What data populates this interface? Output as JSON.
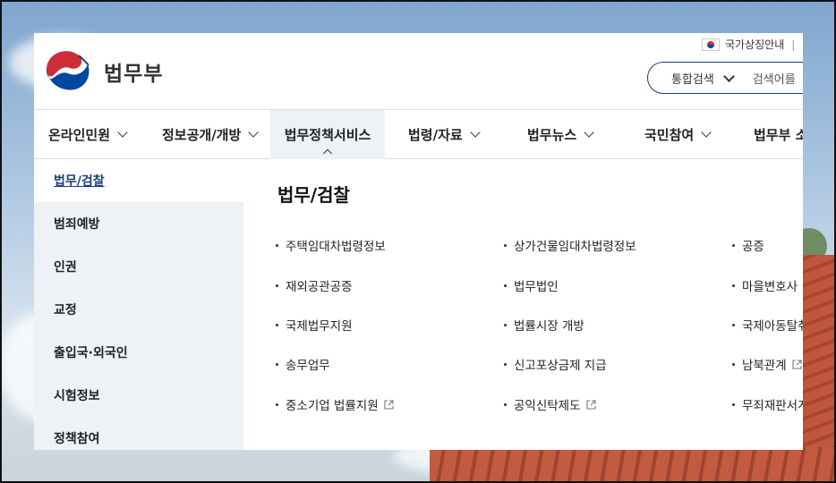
{
  "header": {
    "ministry_name": "법무부",
    "symbol_guide": "국가상징안내",
    "separator": "|",
    "search": {
      "scope": "통합검색",
      "placeholder": "검색어를"
    }
  },
  "gnb": [
    {
      "label": "온라인민원"
    },
    {
      "label": "정보공개/개방"
    },
    {
      "label": "법무정책서비스"
    },
    {
      "label": "법령/자료"
    },
    {
      "label": "법무뉴스"
    },
    {
      "label": "국민참여"
    },
    {
      "label": "법무부 소"
    }
  ],
  "sidebar": [
    {
      "label": "법무/검찰"
    },
    {
      "label": "범죄예방"
    },
    {
      "label": "인권"
    },
    {
      "label": "교정"
    },
    {
      "label": "출입국·외국인"
    },
    {
      "label": "시험정보"
    },
    {
      "label": "정책참여"
    }
  ],
  "content": {
    "title": "법무/검찰",
    "links": [
      {
        "label": "주택임대차법령정보"
      },
      {
        "label": "상가건물임대차법령정보"
      },
      {
        "label": "공증"
      },
      {
        "label": "재외공관공증"
      },
      {
        "label": "법무법인"
      },
      {
        "label": "마을변호사"
      },
      {
        "label": "국제법무지원"
      },
      {
        "label": "법률시장 개방"
      },
      {
        "label": "국제아동탈취"
      },
      {
        "label": "송무업무"
      },
      {
        "label": "신고포상금제 지급"
      },
      {
        "label": "남북관계"
      },
      {
        "label": "중소기업 법률지원"
      },
      {
        "label": "공익신탁제도"
      },
      {
        "label": "무죄재판서게"
      }
    ]
  },
  "colors": {
    "brand_navy": "#1b3f79",
    "brand_red": "#cd2e3a",
    "brand_blue": "#0047a0"
  }
}
